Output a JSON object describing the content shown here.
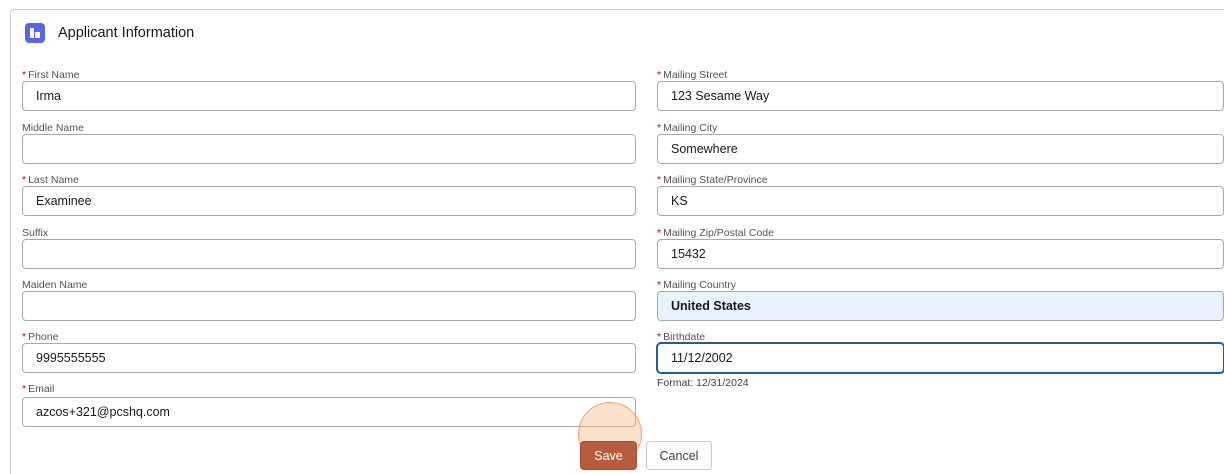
{
  "card": {
    "title": "Applicant Information",
    "icon": "record-icon",
    "icon_color": "#5867e8"
  },
  "left_fields": {
    "first_name": {
      "label": "First Name",
      "required": "*",
      "value": "Irma"
    },
    "middle_name": {
      "label": "Middle Name",
      "value": ""
    },
    "last_name": {
      "label": "Last Name",
      "required": "*",
      "value": "Examinee"
    },
    "suffix": {
      "label": "Suffix",
      "value": ""
    },
    "maiden_name": {
      "label": "Maiden Name",
      "value": ""
    },
    "phone": {
      "label": "Phone",
      "required": "*",
      "value": "9995555555"
    },
    "email": {
      "label": "Email",
      "required": "*",
      "value": "azcos+321@pcshq.com"
    }
  },
  "right_fields": {
    "mailing_street": {
      "label": "Mailing Street",
      "required": "*",
      "value": "123 Sesame Way"
    },
    "mailing_city": {
      "label": "Mailing City",
      "required": "*",
      "value": "Somewhere"
    },
    "mailing_state": {
      "label": "Mailing State/Province",
      "required": "*",
      "value": "KS"
    },
    "mailing_zip": {
      "label": "Mailing Zip/Postal Code",
      "required": "*",
      "value": "15432"
    },
    "mailing_country": {
      "label": "Mailing Country",
      "required": "*",
      "value": "United States"
    },
    "birthdate": {
      "label": "Birthdate",
      "required": "*",
      "value": "11/12/2002",
      "help": "Format: 12/31/2024"
    }
  },
  "buttons": {
    "save_label": "Save",
    "cancel_label": "Cancel"
  },
  "colors": {
    "required": "#ba0517",
    "save_button": "#b55d3e",
    "focus_border": "#1b5f9e"
  }
}
